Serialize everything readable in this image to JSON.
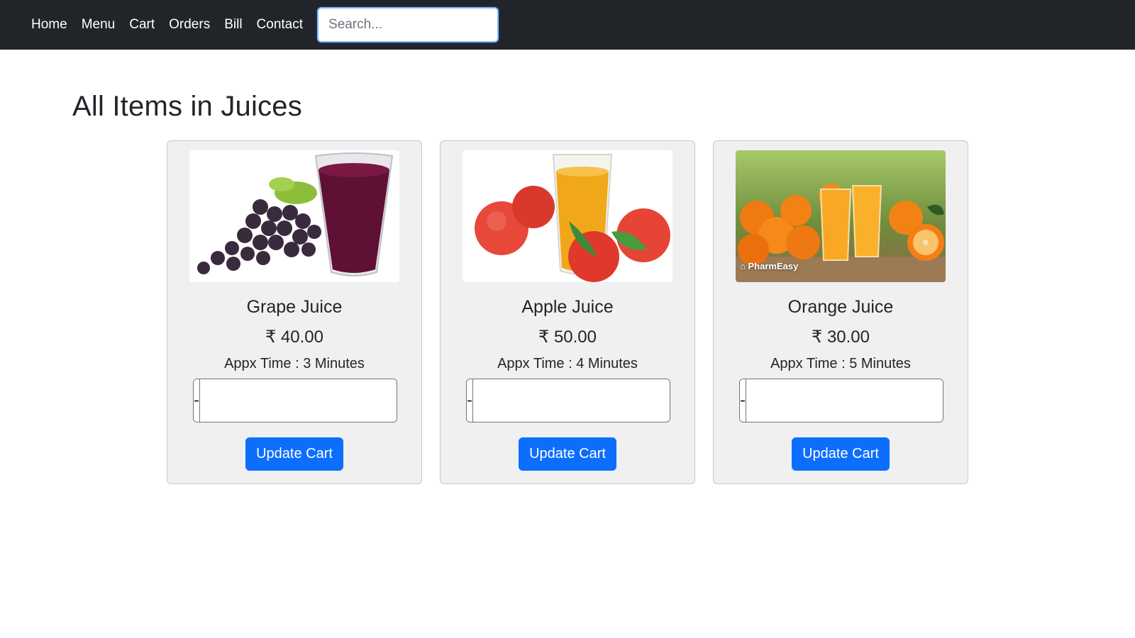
{
  "nav": {
    "links": [
      "Home",
      "Menu",
      "Cart",
      "Orders",
      "Bill",
      "Contact"
    ],
    "search_placeholder": "Search..."
  },
  "page": {
    "title": "All Items in Juices"
  },
  "items": [
    {
      "name": "Grape Juice",
      "price": "₹ 40.00",
      "time": "Appx Time : 3 Minutes",
      "minus": "-",
      "plus": "+",
      "quantity": "",
      "button": "Update Cart",
      "image_icon": "grape-juice-image"
    },
    {
      "name": "Apple Juice",
      "price": "₹ 50.00",
      "time": "Appx Time : 4 Minutes",
      "minus": "-",
      "plus": "+",
      "quantity": "",
      "button": "Update Cart",
      "image_icon": "apple-juice-image"
    },
    {
      "name": "Orange Juice",
      "price": "₹ 30.00",
      "time": "Appx Time : 5 Minutes",
      "minus": "-",
      "plus": "+",
      "quantity": "",
      "button": "Update Cart",
      "image_icon": "orange-juice-image",
      "image_watermark": "PharmEasy"
    }
  ],
  "colors": {
    "navbar": "#212529",
    "primary": "#0d6efd",
    "card": "#f0f0f0"
  }
}
